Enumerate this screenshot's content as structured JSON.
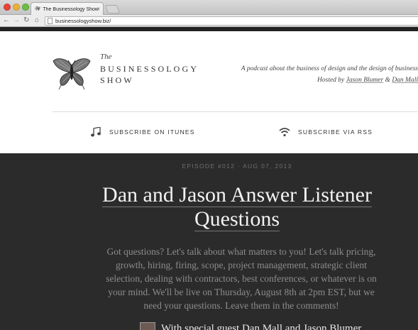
{
  "browser": {
    "tab_title": "The Businessology Show",
    "url": "businessologyshow.biz/"
  },
  "brand": {
    "the": "The",
    "line1": "BUSINESSOLOGY",
    "line2": "SHOW"
  },
  "header": {
    "tagline": "A podcast about the business of design and the design of business",
    "hosted_prefix": "Hosted by",
    "host1": "Jason Blumer",
    "amp": "&",
    "host2": "Dan Mall",
    "subscribe_itunes": "SUBSCRIBE ON ITUNES",
    "subscribe_rss": "SUBSCRIBE VIA RSS"
  },
  "episode": {
    "meta": "EPISODE #012 · AUG 07, 2013",
    "title_line1": "Dan and Jason Answer Listener",
    "title_line2": "Questions",
    "description": "Got questions? Let's talk about what matters to you! Let's talk pricing, growth, hiring, firing, scope, project management, strategic client selection, dealing with contractors, best conferences, or whatever is on your mind. We'll be live on Thursday, August 8th at 2pm EST, but we need your questions. Leave them in the comments!",
    "guest_line": "With special guest Dan Mall and Jason Blumer"
  },
  "icons": {
    "favicon": "butterfly-icon",
    "back": "back-arrow-icon",
    "forward": "forward-arrow-icon",
    "reload": "reload-icon",
    "home": "home-icon",
    "itunes": "music-note-icon",
    "rss": "wifi-rss-icon"
  }
}
